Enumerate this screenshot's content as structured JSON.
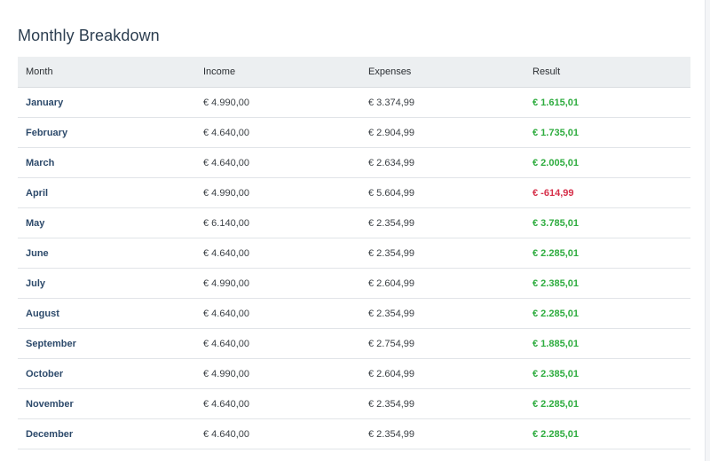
{
  "title": "Monthly Breakdown",
  "columns": [
    "Month",
    "Income",
    "Expenses",
    "Result"
  ],
  "colors": {
    "positive": "#2eac3f",
    "negative": "#d6304a",
    "month": "#2d4a6b"
  },
  "rows": [
    {
      "month": "January",
      "income": "€ 4.990,00",
      "expenses": "€ 3.374,99",
      "result": "€ 1.615,01",
      "status": "pos"
    },
    {
      "month": "February",
      "income": "€ 4.640,00",
      "expenses": "€ 2.904,99",
      "result": "€ 1.735,01",
      "status": "pos"
    },
    {
      "month": "March",
      "income": "€ 4.640,00",
      "expenses": "€ 2.634,99",
      "result": "€ 2.005,01",
      "status": "pos"
    },
    {
      "month": "April",
      "income": "€ 4.990,00",
      "expenses": "€ 5.604,99",
      "result": "€ -614,99",
      "status": "neg"
    },
    {
      "month": "May",
      "income": "€ 6.140,00",
      "expenses": "€ 2.354,99",
      "result": "€ 3.785,01",
      "status": "pos"
    },
    {
      "month": "June",
      "income": "€ 4.640,00",
      "expenses": "€ 2.354,99",
      "result": "€ 2.285,01",
      "status": "pos"
    },
    {
      "month": "July",
      "income": "€ 4.990,00",
      "expenses": "€ 2.604,99",
      "result": "€ 2.385,01",
      "status": "pos"
    },
    {
      "month": "August",
      "income": "€ 4.640,00",
      "expenses": "€ 2.354,99",
      "result": "€ 2.285,01",
      "status": "pos"
    },
    {
      "month": "September",
      "income": "€ 4.640,00",
      "expenses": "€ 2.754,99",
      "result": "€ 1.885,01",
      "status": "pos"
    },
    {
      "month": "October",
      "income": "€ 4.990,00",
      "expenses": "€ 2.604,99",
      "result": "€ 2.385,01",
      "status": "pos"
    },
    {
      "month": "November",
      "income": "€ 4.640,00",
      "expenses": "€ 2.354,99",
      "result": "€ 2.285,01",
      "status": "pos"
    },
    {
      "month": "December",
      "income": "€ 4.640,00",
      "expenses": "€ 2.354,99",
      "result": "€ 2.285,01",
      "status": "pos"
    }
  ]
}
